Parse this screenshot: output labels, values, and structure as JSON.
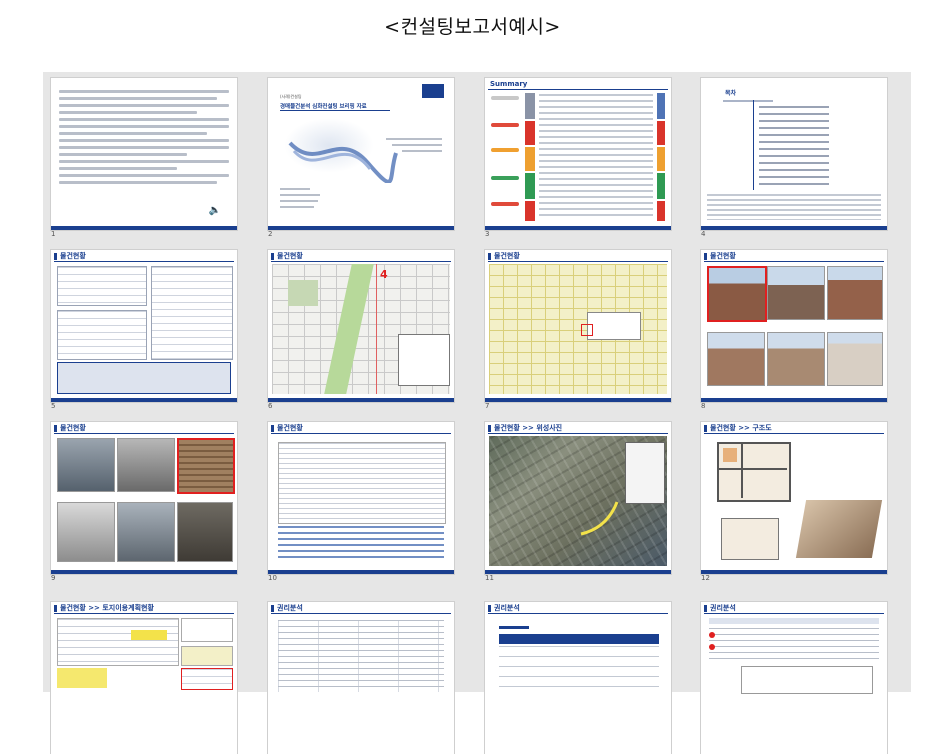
{
  "page": {
    "title": "<컨설팅보고서예시>"
  },
  "slides": [
    {
      "number": "1",
      "caption": ""
    },
    {
      "number": "2",
      "caption": "경매물건분석 심화컨설팅 브리핑 자료"
    },
    {
      "number": "3",
      "caption": "Summary"
    },
    {
      "number": "4",
      "caption": "목차"
    },
    {
      "number": "5",
      "caption": "물건현황"
    },
    {
      "number": "6",
      "caption": "물건현황"
    },
    {
      "number": "7",
      "caption": "물건현황"
    },
    {
      "number": "8",
      "caption": "물건현황"
    },
    {
      "number": "9",
      "caption": "물건현황"
    },
    {
      "number": "10",
      "caption": "물건현황"
    },
    {
      "number": "11",
      "caption": "물건현황 >> 위성사진"
    },
    {
      "number": "12",
      "caption": "물건현황 >> 구조도"
    },
    {
      "number": "13",
      "caption": "물건현황 >> 토지이용계획현황"
    },
    {
      "number": "14",
      "caption": "권리분석"
    },
    {
      "number": "15",
      "caption": "권리분석"
    },
    {
      "number": "16",
      "caption": "권리분석"
    }
  ],
  "colors": {
    "accent": "#1a3f8f",
    "panel": "#e6e6e6",
    "highlight_red": "#e02020",
    "highlight_yellow": "#f3e24a"
  }
}
